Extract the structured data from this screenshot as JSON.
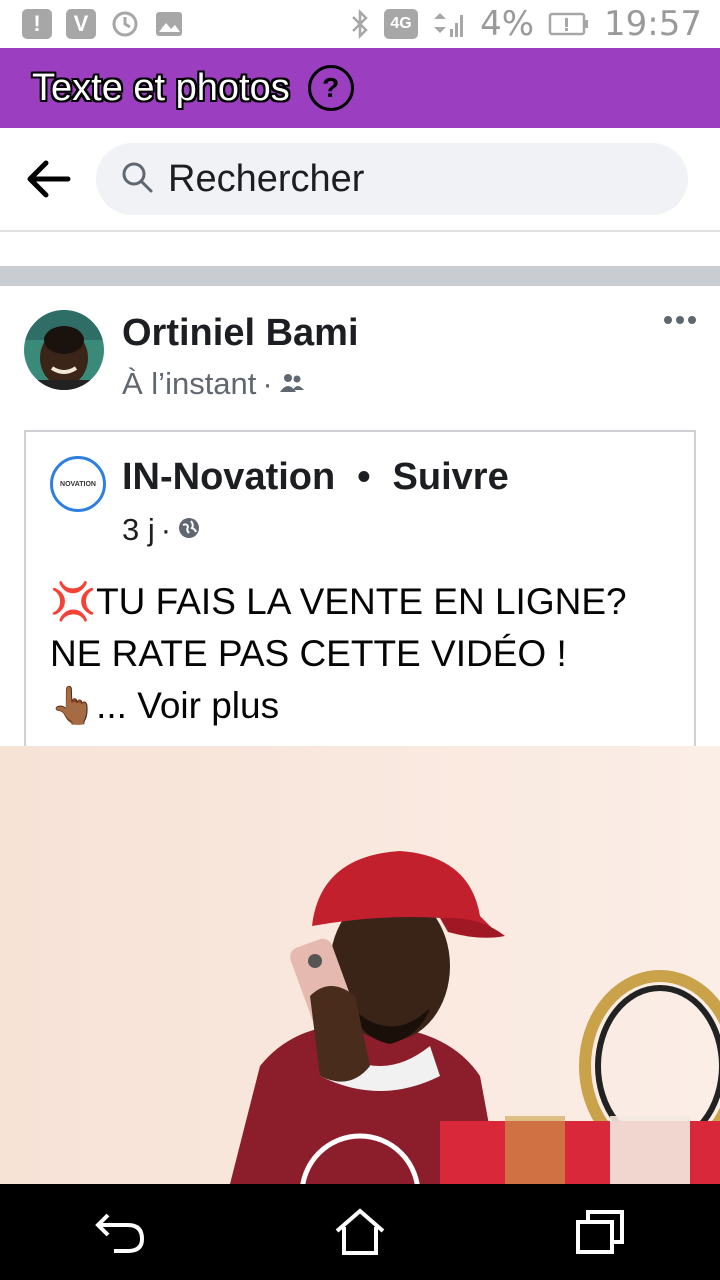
{
  "status_bar": {
    "battery_percent": "4%",
    "time": "19:57",
    "network": "4G",
    "icons": [
      "alert-icon",
      "v-app-icon",
      "sync-icon",
      "image-icon",
      "bluetooth-icon",
      "4g-icon",
      "signal-icon",
      "battery-icon"
    ]
  },
  "title_bar": {
    "title": "Texte et photos",
    "help_icon": "help-icon"
  },
  "search": {
    "back_icon": "back-arrow-icon",
    "placeholder": "Rechercher"
  },
  "post": {
    "author": "Ortiniel Bami",
    "time": "À l’instant",
    "separator": "·",
    "audience_icon": "friends-icon",
    "shared": {
      "page_name": "IN-Novation",
      "bullet": "•",
      "follow_label": "Suivre",
      "time": "3 j",
      "separator": "·",
      "audience_icon": "globe-icon",
      "page_logo_text": "NOVATION",
      "text_line1": "💢TU FAIS LA VENTE EN LIGNE?",
      "text_line2": "NE RATE PAS CETTE VIDÉO !",
      "text_line3_emoji": "👆🏾",
      "see_more": "... Voir plus"
    }
  },
  "nav": {
    "back": "back-icon",
    "home": "home-icon",
    "recents": "recents-icon"
  },
  "colors": {
    "title_bar": "#9b3fc0",
    "search_bg": "#f0f2f5",
    "separator": "#c9ccd1"
  }
}
